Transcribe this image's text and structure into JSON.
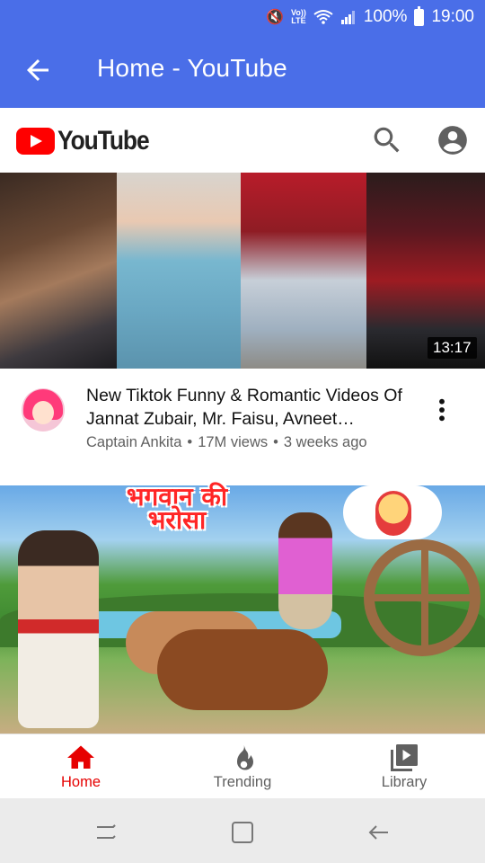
{
  "status_bar": {
    "volte_label": "Vo))",
    "lte_label": "LTE",
    "battery": "100%",
    "battery_level": 1.0,
    "time": "19:00"
  },
  "app_bar": {
    "title": "Home - YouTube",
    "back_icon": "arrow-back-icon"
  },
  "youtube_header": {
    "logo_text": "YouTube",
    "logo_color": "#ff0000",
    "search_icon": "search-icon",
    "account_icon": "account-icon"
  },
  "feed": {
    "videos": [
      {
        "duration": "13:17",
        "title": "New Tiktok Funny & Romantic Videos Of Jannat Zubair, Mr. Faisu, Avneet…",
        "channel": "Captain Ankita",
        "views": "17M views",
        "age": "3 weeks ago",
        "more_icon": "more-vert-icon"
      },
      {
        "thumbnail_text": "भगवान की भरोसा"
      }
    ]
  },
  "bottom_nav": {
    "items": [
      {
        "label": "Home",
        "icon": "home-icon",
        "active": true
      },
      {
        "label": "Trending",
        "icon": "trending-flame-icon",
        "active": false
      },
      {
        "label": "Library",
        "icon": "library-icon",
        "active": false
      }
    ]
  },
  "system_nav": {
    "recent_icon": "recent-apps-icon",
    "home_icon": "home-square-icon",
    "back_icon": "back-icon"
  },
  "colors": {
    "app_bar": "#4a6ee8",
    "accent_red": "#ff0000",
    "active_red": "#e60000",
    "secondary_text": "#606060"
  }
}
